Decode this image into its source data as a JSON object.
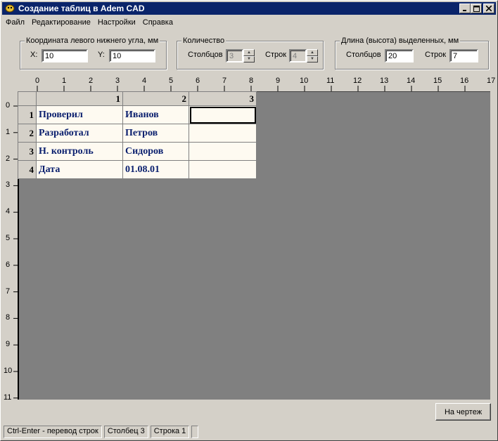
{
  "window": {
    "title": "Создание таблиц в Adem CAD",
    "controls": [
      "minimize",
      "maximize",
      "close"
    ]
  },
  "menu": [
    "Файл",
    "Редактирование",
    "Настройки",
    "Справка"
  ],
  "corner_group": {
    "legend": "Координата левого нижнего угла, мм",
    "x_label": "X:",
    "x_value": "10",
    "y_label": "Y:",
    "y_value": "10"
  },
  "count_group": {
    "legend": "Количество",
    "columns_label": "Столбцов",
    "columns_value": "3",
    "rows_label": "Строк",
    "rows_value": "4"
  },
  "size_group": {
    "legend": "Длина (высота) выделенных, мм",
    "columns_label": "Столбцов",
    "columns_value": "20",
    "rows_label": "Строк",
    "rows_value": "7"
  },
  "ruler": {
    "horizontal": [
      "0",
      "1",
      "2",
      "3",
      "4",
      "5",
      "6",
      "7",
      "8",
      "9",
      "10",
      "11",
      "12",
      "13",
      "14",
      "15",
      "16",
      "17"
    ],
    "vertical": [
      "0",
      "1",
      "2",
      "3",
      "4",
      "5",
      "6",
      "7",
      "8",
      "9",
      "10",
      "11"
    ]
  },
  "grid": {
    "col_headers": [
      "1",
      "2",
      "3"
    ],
    "row_headers": [
      "1",
      "2",
      "3",
      "4"
    ],
    "rows": [
      [
        "Проверил",
        "Иванов",
        ""
      ],
      [
        "Разработал",
        "Петров",
        ""
      ],
      [
        "Н. контроль",
        "Сидоров",
        ""
      ],
      [
        "Дата",
        "01.08.01",
        ""
      ]
    ]
  },
  "button": {
    "label": "На чертеж"
  },
  "status": [
    "Ctrl-Enter - перевод строк",
    "Столбец 3",
    "Строка 1"
  ]
}
